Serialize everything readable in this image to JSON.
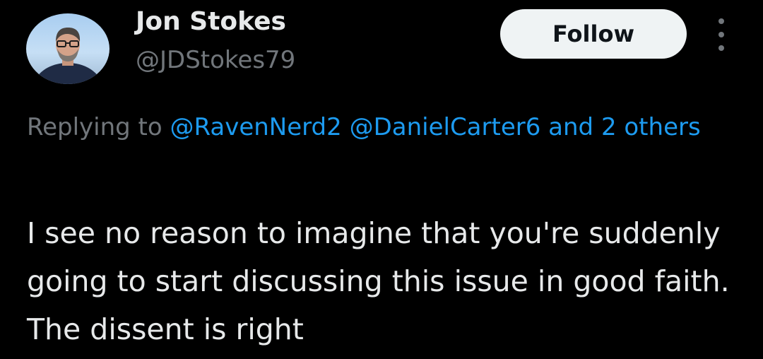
{
  "author": {
    "display_name": "Jon Stokes",
    "handle": "@JDStokes79",
    "avatar_icon": "profile-photo"
  },
  "follow_button": {
    "label": "Follow"
  },
  "more_menu": {
    "icon": "more-vertical-icon"
  },
  "reply": {
    "prefix": "Replying to",
    "mentions": [
      "@RavenNerd2",
      "@DanielCarter6"
    ],
    "and_others": "and 2 others"
  },
  "tweet": {
    "text": "I see no reason to imagine that you're suddenly going to start discussing this issue in good faith.  The dissent is right"
  },
  "colors": {
    "background": "#000000",
    "primary_text": "#e7e9ea",
    "secondary_text": "#71767b",
    "link": "#1d9bf0",
    "follow_button_bg": "#eff3f4"
  }
}
